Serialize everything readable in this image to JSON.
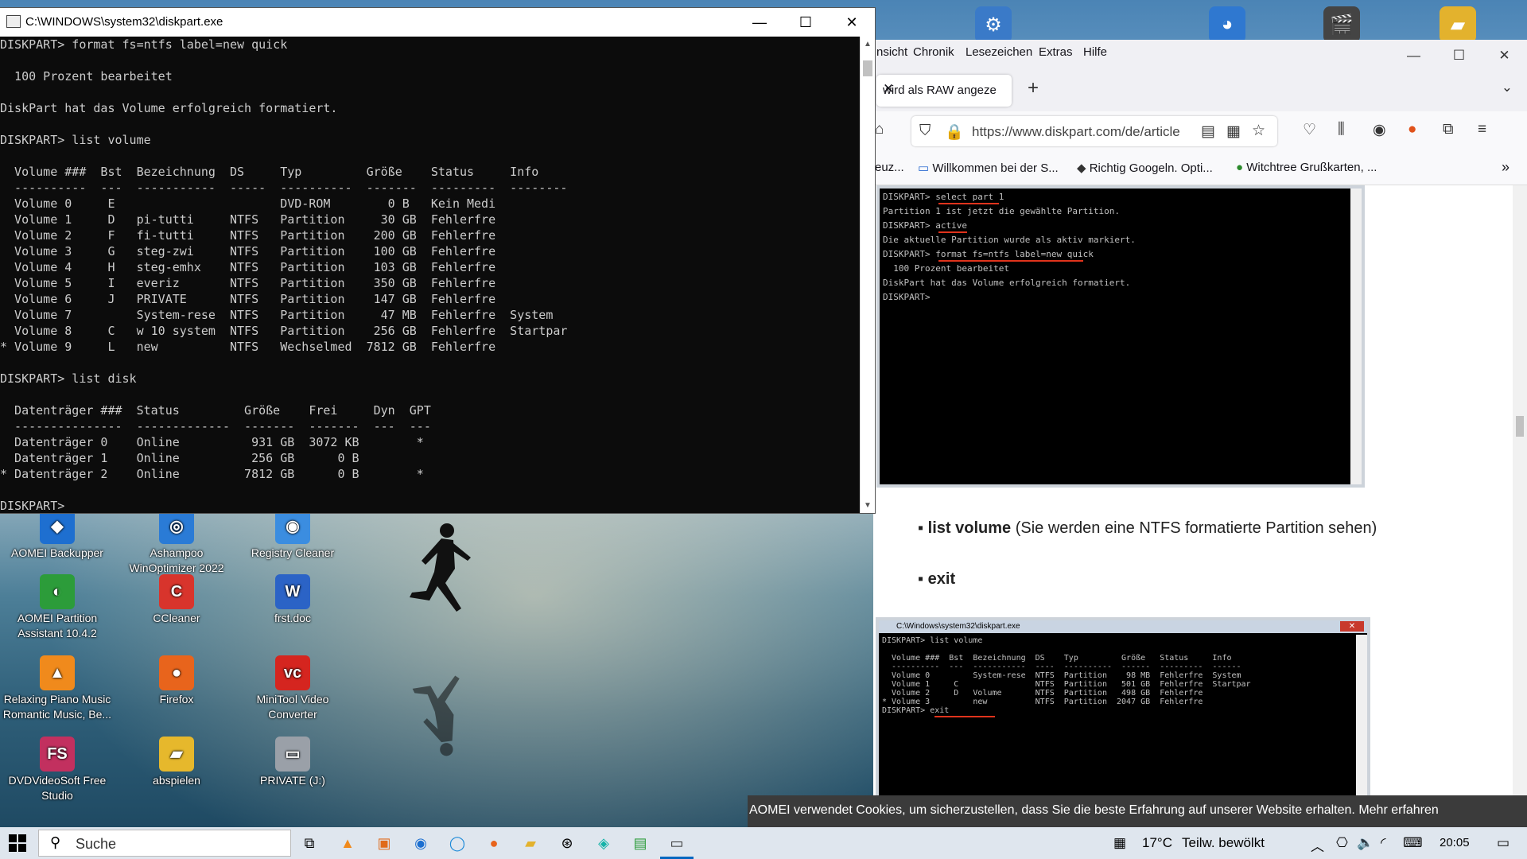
{
  "console": {
    "title": "C:\\WINDOWS\\system32\\diskpart.exe",
    "lines": [
      "DISKPART> format fs=ntfs label=new quick",
      "",
      "  100 Prozent bearbeitet",
      "",
      "DiskPart hat das Volume erfolgreich formatiert.",
      "",
      "DISKPART> list volume",
      "",
      "  Volume ###  Bst  Bezeichnung  DS     Typ         Größe    Status     Info",
      "  ----------  ---  -----------  -----  ----------  -------  ---------  --------",
      "  Volume 0     E                       DVD-ROM        0 B   Kein Medi",
      "  Volume 1     D   pi-tutti     NTFS   Partition     30 GB  Fehlerfre",
      "  Volume 2     F   fi-tutti     NTFS   Partition    200 GB  Fehlerfre",
      "  Volume 3     G   steg-zwi     NTFS   Partition    100 GB  Fehlerfre",
      "  Volume 4     H   steg-emhx    NTFS   Partition    103 GB  Fehlerfre",
      "  Volume 5     I   everiz       NTFS   Partition    350 GB  Fehlerfre",
      "  Volume 6     J   PRIVATE      NTFS   Partition    147 GB  Fehlerfre",
      "  Volume 7         System-rese  NTFS   Partition     47 MB  Fehlerfre  System",
      "  Volume 8     C   w 10 system  NTFS   Partition    256 GB  Fehlerfre  Startpar",
      "* Volume 9     L   new          NTFS   Wechselmed  7812 GB  Fehlerfre",
      "",
      "DISKPART> list disk",
      "",
      "  Datenträger ###  Status         Größe    Frei     Dyn  GPT",
      "  ---------------  -------------  -------  -------  ---  ---",
      "  Datenträger 0    Online          931 GB  3072 KB        *",
      "  Datenträger 1    Online          256 GB      0 B",
      "* Datenträger 2    Online         7812 GB      0 B        *",
      "",
      "DISKPART>"
    ]
  },
  "browser": {
    "menu": [
      "nsicht",
      "Chronik",
      "Lesezeichen",
      "Extras",
      "Hilfe"
    ],
    "tab_label": "wird als RAW angeze",
    "url": "https://www.diskpart.com/de/article",
    "bookmarks": [
      "euz...",
      "Willkommen bei der S...",
      "Richtig Googeln. Opti...",
      "Witchtree Grußkarten, ..."
    ],
    "shot1_lines": [
      "DISKPART> select part 1",
      "Partition 1 ist jetzt die gewählte Partition.",
      "DISKPART> active",
      "Die aktuelle Partition wurde als aktiv markiert.",
      "DISKPART> format fs=ntfs label=new quick",
      "  100 Prozent bearbeitet",
      "DiskPart hat das Volume erfolgreich formatiert.",
      "DISKPART>"
    ],
    "bullet1_bold": "list volume",
    "bullet1_rest": " (Sie werden eine NTFS formatierte Partition sehen)",
    "bullet2_bold": "exit",
    "shot2_title": "C:\\Windows\\system32\\diskpart.exe",
    "shot2_lines": [
      "DISKPART> list volume",
      "",
      "  Volume ###  Bst  Bezeichnung  DS    Typ         Größe   Status     Info",
      "  ----------  ---  -----------  ----  ----------  ------  ---------  ------",
      "  Volume 0         System-rese  NTFS  Partition    98 MB  Fehlerfre  System",
      "  Volume 1     C                NTFS  Partition   501 GB  Fehlerfre  Startpar",
      "  Volume 2     D   Volume       NTFS  Partition   498 GB  Fehlerfre",
      "* Volume 3         new          NTFS  Partition  2047 GB  Fehlerfre",
      "DISKPART> exit"
    ],
    "cookie_text": "AOMEI verwendet Cookies, um sicherzustellen, dass Sie die beste Erfahrung auf unserer Website erhalten.  Mehr erfahren"
  },
  "desktop_icons": [
    {
      "label": "AOMEI Backupper",
      "color": "#1e6fd0",
      "glyph": "◆"
    },
    {
      "label": "Ashampoo WinOptimizer 2022",
      "color": "#2a7bd6",
      "glyph": "◎"
    },
    {
      "label": "Registry Cleaner",
      "color": "#3b8de0",
      "glyph": "◉"
    },
    {
      "label": "AOMEI Partition Assistant 10.4.2",
      "color": "#2c9c3a",
      "glyph": "◐"
    },
    {
      "label": "CCleaner",
      "color": "#d8342c",
      "glyph": "C"
    },
    {
      "label": "frst.doc",
      "color": "#2b63c6",
      "glyph": "W"
    },
    {
      "label": "Relaxing Piano Music Romantic Music, Be...",
      "color": "#f08a1c",
      "glyph": "▲"
    },
    {
      "label": "Firefox",
      "color": "#e8641c",
      "glyph": "●"
    },
    {
      "label": "MiniTool Video Converter",
      "color": "#d5251f",
      "glyph": "vc"
    },
    {
      "label": "DVDVideoSoft Free Studio",
      "color": "#c2305f",
      "glyph": "FS"
    },
    {
      "label": "abspielen",
      "color": "#e6b82c",
      "glyph": "▰"
    },
    {
      "label": "PRIVATE (J:)",
      "color": "#9aa0a8",
      "glyph": "▭"
    }
  ],
  "taskbar": {
    "search_placeholder": "Suche",
    "weather_temp": "17°C",
    "weather_text": "Teilw. bewölkt",
    "time": "20:05"
  }
}
